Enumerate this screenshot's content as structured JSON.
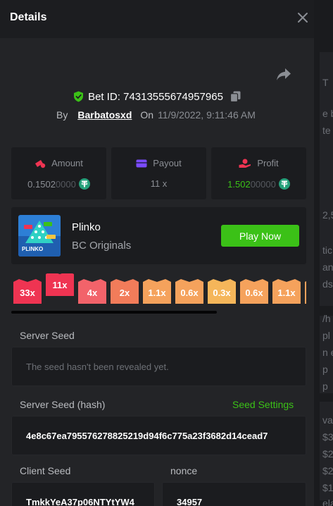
{
  "panel": {
    "title": "Details"
  },
  "bet": {
    "bet_id": "Bet ID: 74313555674957965",
    "by_label": "By",
    "user": "Barbatosxd",
    "on_label": "On",
    "time": "11/9/2022, 9:11:46 AM"
  },
  "stats": {
    "amount": {
      "label": "Amount",
      "value_main": "0.1502",
      "value_dim": "0000"
    },
    "payout": {
      "label": "Payout",
      "value": "11 x"
    },
    "profit": {
      "label": "Profit",
      "value_main": "1.502",
      "value_dim": "00000"
    }
  },
  "game": {
    "name": "Plinko",
    "provider": "BC Originals",
    "play_label": "Play Now",
    "thumb_text": "PLINKO"
  },
  "multipliers": [
    {
      "label": "33x",
      "color": "#ef3452",
      "lifted": false
    },
    {
      "label": "11x",
      "color": "#ef3452",
      "lifted": true
    },
    {
      "label": "4x",
      "color": "#f2636a",
      "lifted": false
    },
    {
      "label": "2x",
      "color": "#f27c5a",
      "lifted": false
    },
    {
      "label": "1.1x",
      "color": "#f5a25c",
      "lifted": false
    },
    {
      "label": "0.6x",
      "color": "#f5a25c",
      "lifted": false
    },
    {
      "label": "0.3x",
      "color": "#f5b65a",
      "lifted": false
    },
    {
      "label": "0.6x",
      "color": "#f5a25c",
      "lifted": false
    },
    {
      "label": "1.1x",
      "color": "#f5a25c",
      "lifted": false
    },
    {
      "label": "",
      "color": "#f5a25c",
      "lifted": false
    }
  ],
  "server_seed": {
    "label": "Server Seed",
    "value": "The seed hasn't been revealed yet."
  },
  "server_seed_hash": {
    "label": "Server Seed (hash)",
    "settings_label": "Seed Settings",
    "value": "4e8c67ea795576278825219d94f6c775a23f3682d14cead7"
  },
  "client_seed": {
    "label": "Client Seed",
    "value": "TmkkYeA37p06NTYtYW4"
  },
  "nonce": {
    "label": "nonce",
    "value": "34957"
  },
  "backdrop_text": [
    "T",
    "e b",
    "te",
    "2,5",
    "tic",
    "an",
    "ds",
    "/h",
    "pl",
    "n e",
    " p",
    " p",
    "va",
    "$3",
    "$2",
    "$2",
    "$1",
    "ela"
  ],
  "colors": {
    "accent_green": "#3bc117",
    "panel_bg": "#232427",
    "card_bg": "#1b1c1f"
  }
}
